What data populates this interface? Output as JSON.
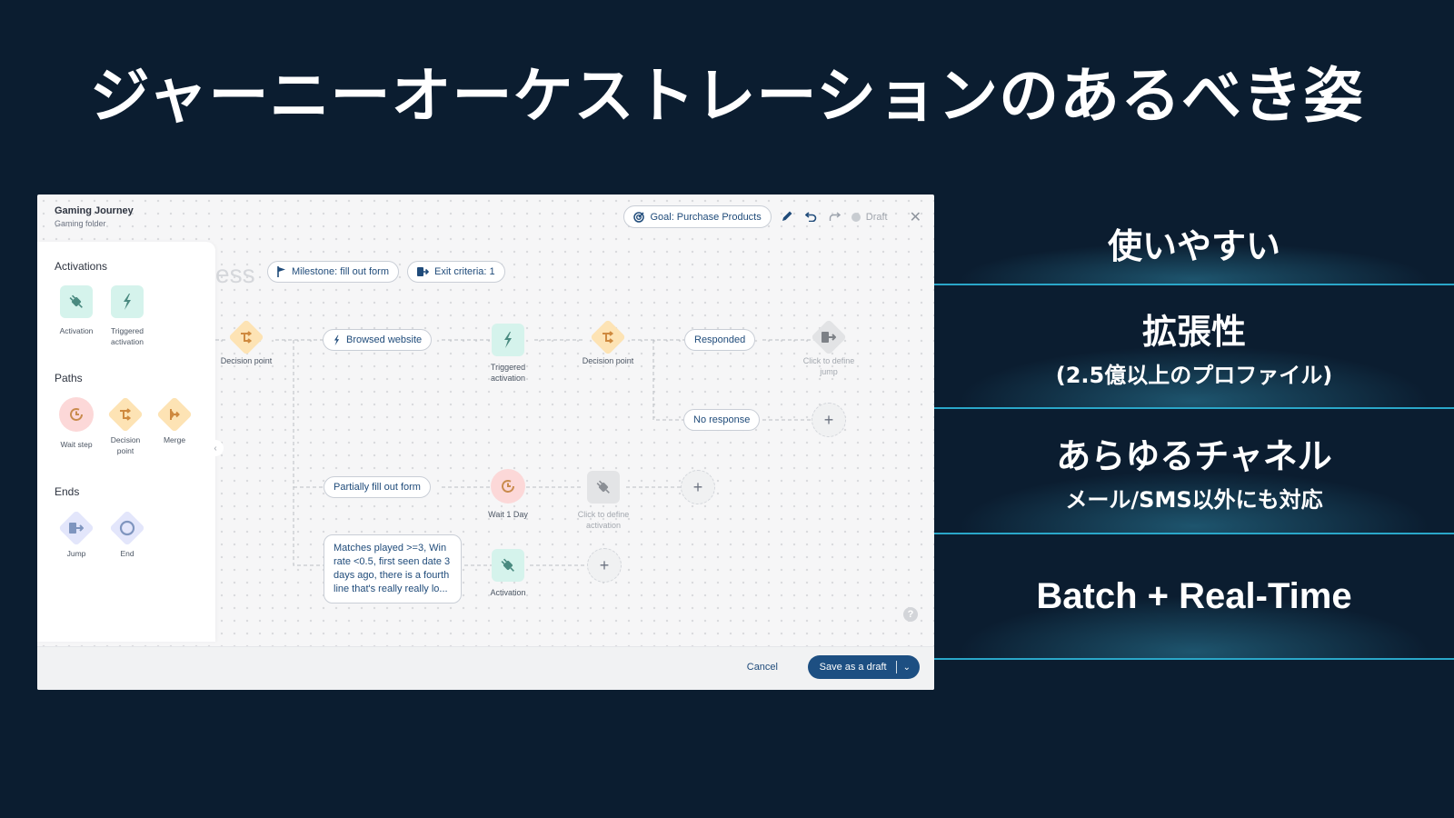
{
  "slide": {
    "title": "ジャーニーオーケストレーションのあるべき姿"
  },
  "app": {
    "journey_name": "Gaming Journey",
    "folder_name": "Gaming folder",
    "goal_label": "Goal: Purchase Products",
    "status_label": "Draft",
    "faded_title": "ess",
    "milestone_label": "Milestone: fill out form",
    "exit_criteria_label": "Exit criteria: 1",
    "palette": {
      "activations_heading": "Activations",
      "activations": [
        {
          "label": "Activation",
          "icon": "plug-icon"
        },
        {
          "label": "Triggered activation",
          "icon": "lightning-icon"
        }
      ],
      "paths_heading": "Paths",
      "paths": [
        {
          "label": "Wait step",
          "icon": "clock-icon"
        },
        {
          "label": "Decision point",
          "icon": "split-arrow-icon"
        },
        {
          "label": "Merge",
          "icon": "merge-icon"
        }
      ],
      "ends_heading": "Ends",
      "ends": [
        {
          "label": "Jump",
          "icon": "exit-door-icon"
        },
        {
          "label": "End",
          "icon": "circle-icon"
        }
      ]
    },
    "canvas": {
      "decision_point_1": "Decision point",
      "branch_browsed": "Browsed website",
      "triggered_activation": "Triggered activation",
      "decision_point_2": "Decision point",
      "branch_responded": "Responded",
      "jump_placeholder": "Click to define jump",
      "branch_no_response": "No response",
      "branch_partial_form": "Partially fill out form",
      "wait_label": "Wait 1 Day",
      "activation_placeholder": "Click to define activation",
      "branch_condition": "Matches played >=3, Win rate <0.5, first seen date 3 days ago, there is a fourth line that's really really lo...",
      "activation_label": "Activation"
    },
    "footer": {
      "cancel_label": "Cancel",
      "save_label": "Save as a draft"
    }
  },
  "features": [
    {
      "title": "使いやすい",
      "sub": ""
    },
    {
      "title": "拡張性",
      "sub": "(2.5億以上のプロファイル)"
    },
    {
      "title": "あらゆるチャネル",
      "sub": "メール/SMS以外にも対応"
    },
    {
      "title": "Batch + Real-Time",
      "sub": ""
    }
  ],
  "colors": {
    "background": "#0b1d30",
    "accent_line": "#2aa7c9",
    "primary_button": "#1d4f82",
    "link_text": "#1f4b7a"
  }
}
